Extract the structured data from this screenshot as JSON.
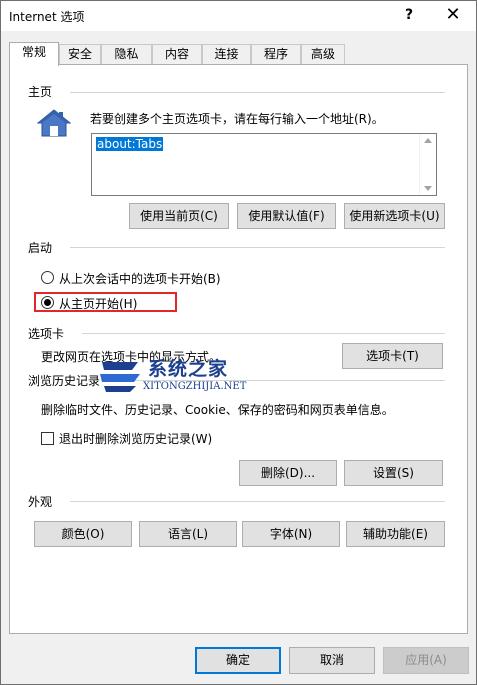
{
  "window": {
    "title": "Internet 选项",
    "help_label": "?",
    "close_label": "✕"
  },
  "tabs": [
    {
      "label": "常规",
      "active": true
    },
    {
      "label": "安全"
    },
    {
      "label": "隐私"
    },
    {
      "label": "内容"
    },
    {
      "label": "连接"
    },
    {
      "label": "程序"
    },
    {
      "label": "高级"
    }
  ],
  "homepage": {
    "group_label": "主页",
    "instruction": "若要创建多个主页选项卡，请在每行输入一个地址(R)。",
    "url_value": "about:Tabs",
    "icon": "house-icon",
    "buttons": {
      "use_current": "使用当前页(C)",
      "use_default": "使用默认值(F)",
      "use_new_tab": "使用新选项卡(U)"
    }
  },
  "startup": {
    "group_label": "启动",
    "option_last_session": "从上次会话中的选项卡开始(B)",
    "option_homepage": "从主页开始(H)",
    "selected": "homepage"
  },
  "tabs_section": {
    "group_label": "选项卡",
    "description": "更改网页在选项卡中的显示方式。",
    "button": "选项卡(T)"
  },
  "history": {
    "group_label": "浏览历史记录",
    "description": "删除临时文件、历史记录、Cookie、保存的密码和网页表单信息。",
    "checkbox_label": "退出时删除浏览历史记录(W)",
    "checkbox_checked": false,
    "delete_button": "删除(D)...",
    "settings_button": "设置(S)"
  },
  "appearance": {
    "group_label": "外观",
    "colors_button": "颜色(O)",
    "languages_button": "语言(L)",
    "fonts_button": "字体(N)",
    "accessibility_button": "辅助功能(E)"
  },
  "footer": {
    "ok_button": "确定",
    "cancel_button": "取消",
    "apply_button": "应用(A)"
  },
  "watermark": {
    "title": "系统之家",
    "url": "XITONGZHIJIA.NET"
  },
  "colors": {
    "accent": "#0078d7",
    "highlight_border": "#e3262a",
    "watermark_blue": "#1d3f8f"
  }
}
